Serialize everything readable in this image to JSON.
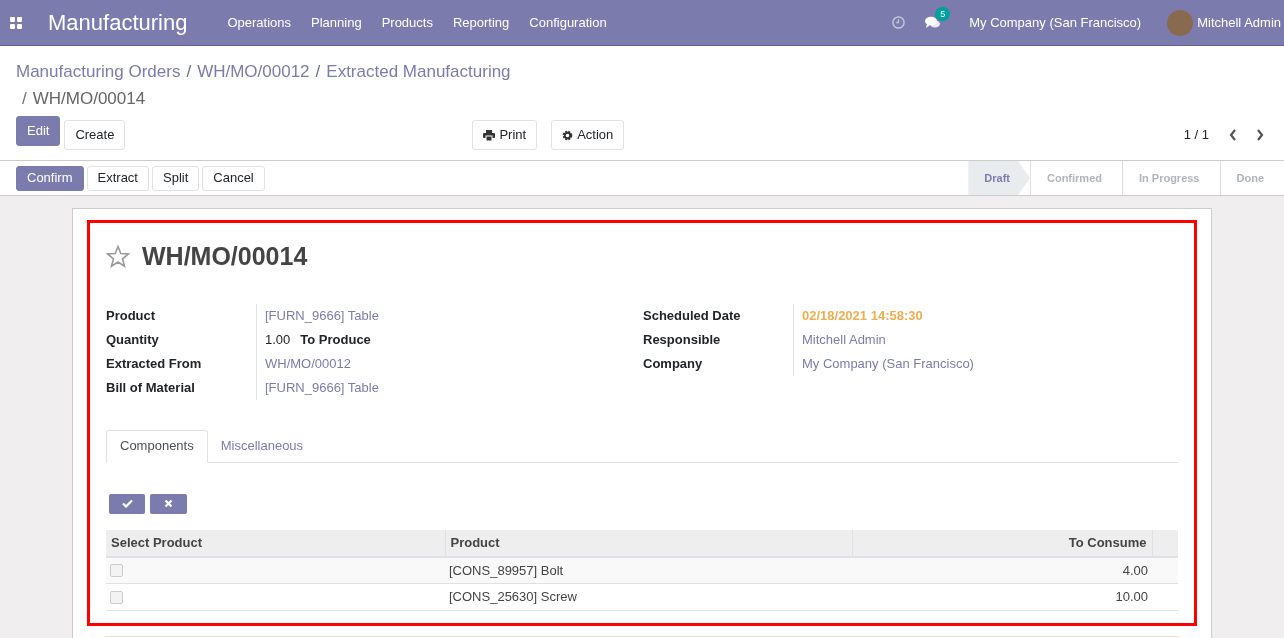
{
  "navbar": {
    "app_title": "Manufacturing",
    "menu": [
      "Operations",
      "Planning",
      "Products",
      "Reporting",
      "Configuration"
    ],
    "messages_badge": "5",
    "company": "My Company (San Francisco)",
    "user": "Mitchell Admin"
  },
  "breadcrumbs": [
    {
      "label": "Manufacturing Orders",
      "link": true
    },
    {
      "separator": "/",
      "label": "WH/MO/00012",
      "link": true
    },
    {
      "separator": "/",
      "label": "Extracted Manufacturing",
      "link": true
    },
    {
      "separator": "/",
      "label": "WH/MO/00014",
      "link": false
    }
  ],
  "control_buttons": [
    {
      "label": "Edit",
      "primary": true
    },
    {
      "label": "Create",
      "primary": false
    }
  ],
  "action_buttons": [
    {
      "label": "Print",
      "kind": "print"
    },
    {
      "label": "Action",
      "kind": "gear"
    }
  ],
  "pager": "1 / 1",
  "header_buttons": [
    {
      "label": "Confirm",
      "primary": true
    },
    {
      "label": "Extract",
      "primary": false
    },
    {
      "label": "Split",
      "primary": false
    },
    {
      "label": "Cancel",
      "primary": false
    }
  ],
  "stages": [
    {
      "label": "Draft",
      "selected": true
    },
    {
      "label": "Confirmed",
      "selected": false
    },
    {
      "label": "In Progress",
      "selected": false
    },
    {
      "label": "Done",
      "selected": false
    }
  ],
  "record": {
    "title": "WH/MO/00014",
    "starred": false,
    "left_fields": [
      {
        "label": "Product",
        "kind": "link",
        "value": "[FURN_9666] Table"
      },
      {
        "label": "Quantity",
        "kind": "qty",
        "value": "1.00",
        "suffix": "To Produce"
      },
      {
        "label": "Extracted From",
        "kind": "link",
        "value": "WH/MO/00012"
      },
      {
        "label": "Bill of Material",
        "kind": "link",
        "value": "[FURN_9666] Table"
      }
    ],
    "right_fields": [
      {
        "label": "Scheduled Date",
        "kind": "warning",
        "value": "02/18/2021 14:58:30"
      },
      {
        "label": "Responsible",
        "kind": "link",
        "value": "Mitchell Admin"
      },
      {
        "label": "Company",
        "kind": "link",
        "value": "My Company (San Francisco)"
      }
    ]
  },
  "tabs": [
    {
      "label": "Components",
      "selected": true
    },
    {
      "label": "Miscellaneous",
      "selected": false
    }
  ],
  "table": {
    "columns": [
      "Select Product",
      "Product",
      "To Consume"
    ],
    "rows": [
      {
        "checked": false,
        "product": "[CONS_89957] Bolt",
        "to_consume": "4.00"
      },
      {
        "checked": false,
        "product": "[CONS_25630] Screw",
        "to_consume": "10.00"
      }
    ]
  }
}
